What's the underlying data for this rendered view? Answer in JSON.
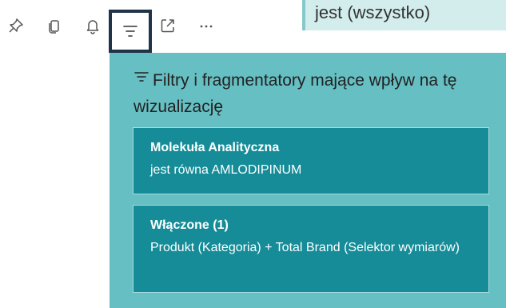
{
  "toolbar": {
    "icons": [
      "pin-icon",
      "copy-icon",
      "bell-icon",
      "filter-icon",
      "focus-mode-icon",
      "more-options-icon"
    ],
    "active": "filter-icon"
  },
  "background_value": "jest (wszystko)",
  "filter_panel": {
    "title": "Filtry i fragmentatory mające wpływ na tę wizualizację",
    "filters": [
      {
        "title": "Molekuła Analityczna",
        "description": "jest równa AMLODIPINUM"
      },
      {
        "title": "Włączone (1)",
        "description": "Produkt (Kategoria) + Total Brand (Selektor wymiarów)"
      }
    ]
  },
  "colors": {
    "panel_bg": "#66bfc2",
    "card_bg": "#158c98",
    "card_text": "#ffffff",
    "active_icon_border": "#1f3448",
    "value_bg": "#d3ecec"
  }
}
